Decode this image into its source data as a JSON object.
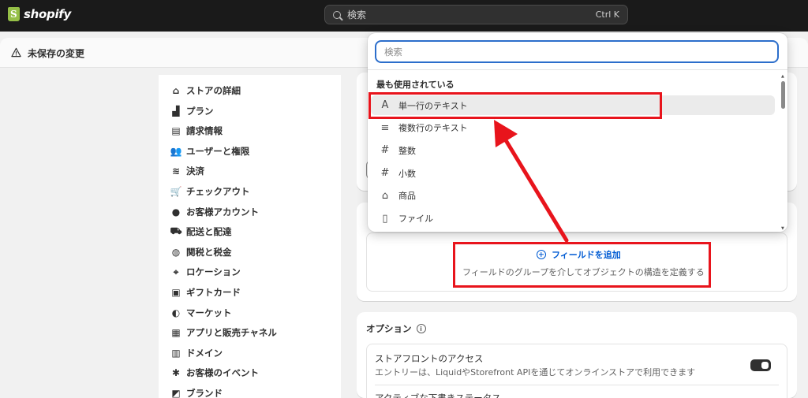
{
  "topbar": {
    "logo_text": "shopify",
    "search_placeholder": "検索",
    "search_shortcut": "Ctrl K"
  },
  "savebar": {
    "label": "未保存の変更"
  },
  "sidebar": {
    "items": [
      {
        "label": "ストアの詳細",
        "icon": "store-icon"
      },
      {
        "label": "プラン",
        "icon": "plan-icon"
      },
      {
        "label": "請求情報",
        "icon": "billing-icon"
      },
      {
        "label": "ユーザーと権限",
        "icon": "users-icon"
      },
      {
        "label": "決済",
        "icon": "payments-icon"
      },
      {
        "label": "チェックアウト",
        "icon": "cart-icon"
      },
      {
        "label": "お客様アカウント",
        "icon": "person-icon"
      },
      {
        "label": "配送と配達",
        "icon": "truck-icon"
      },
      {
        "label": "関税と税金",
        "icon": "tax-icon"
      },
      {
        "label": "ロケーション",
        "icon": "location-icon"
      },
      {
        "label": "ギフトカード",
        "icon": "gift-card-icon"
      },
      {
        "label": "マーケット",
        "icon": "globe-icon"
      },
      {
        "label": "アプリと販売チャネル",
        "icon": "apps-icon"
      },
      {
        "label": "ドメイン",
        "icon": "domain-icon"
      },
      {
        "label": "お客様のイベント",
        "icon": "events-icon"
      },
      {
        "label": "ブランド",
        "icon": "brand-icon"
      }
    ]
  },
  "fields_card": {
    "add_field_label": "フィールドを追加",
    "add_field_desc": "フィールドのグループを介してオブジェクトの構造を定義する"
  },
  "options_card": {
    "title": "オプション",
    "storefront_access_label": "ストアフロントのアクセス",
    "storefront_access_desc": "エントリーは、LiquidやStorefront APIを通じてオンラインストアで利用できます",
    "next_label": "アクティブな下書きステータス"
  },
  "popover": {
    "search_placeholder": "検索",
    "section_heading": "最も使用されている",
    "items": [
      {
        "label": "単一行のテキスト",
        "icon": "A"
      },
      {
        "label": "複数行のテキスト",
        "icon": "≡"
      },
      {
        "label": "整数",
        "icon": "#"
      },
      {
        "label": "小数",
        "icon": "#"
      },
      {
        "label": "商品",
        "icon": "⌂"
      },
      {
        "label": "ファイル",
        "icon": "▯"
      }
    ]
  },
  "annotation": {
    "color": "#e8141c"
  }
}
